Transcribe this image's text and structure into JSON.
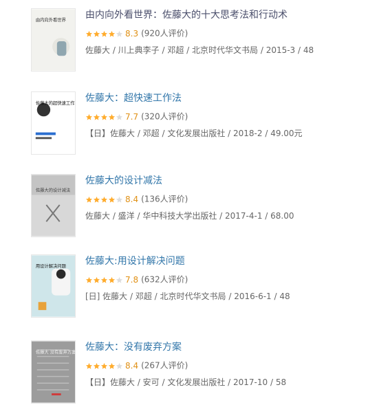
{
  "colors": {
    "title": "#37a",
    "star_on": "#ffac2d",
    "star_off": "#dddddd",
    "score": "#e09015",
    "meta": "#666666"
  },
  "books": [
    {
      "title": "由内向外看世界：佐藤大的十大思考法和行动术",
      "stars": 4,
      "score": "8.3",
      "count": "(920人评价)",
      "pub": "佐藤大 / 川上典李子 / 邓超 / 北京时代华文书局 / 2015-3 / 48",
      "title_color": "#4a4e6b",
      "cover": {
        "bg": "#f2f2ee",
        "text": "由内向外看世界",
        "text_color": "#333333",
        "accent": "#6a8a9a"
      }
    },
    {
      "title": "佐藤大：超快速工作法",
      "stars": 4,
      "score": "7.7",
      "count": "(320人评价)",
      "pub": "【日】佐藤大 / 邓超 / 文化发展出版社 / 2018-2 / 49.00元",
      "title_color": "#3377aa",
      "cover": {
        "bg": "#ffffff",
        "text": "佐藤大的超快速工作法",
        "text_color": "#111111",
        "accent": "#2b6fd0"
      }
    },
    {
      "title": "佐藤大的设计减法",
      "stars": 4,
      "score": "8.4",
      "count": "(136人评价)",
      "pub": "佐藤大 / 盛洋 / 华中科技大学出版社 / 2017-4-1 / 68.00",
      "title_color": "#3377aa",
      "cover": {
        "bg": "#d8d8d8",
        "text": "佐藤大的设计减法",
        "text_color": "#444444",
        "accent": "#9a9a9a"
      }
    },
    {
      "title": "佐藤大:用设计解决问题",
      "stars": 4,
      "score": "7.8",
      "count": "(632人评价)",
      "pub": "[日] 佐藤大 / 邓超 / 北京时代华文书局 / 2016-6-1 / 48",
      "title_color": "#3377aa",
      "cover": {
        "bg": "#cfe6ea",
        "text": "用设计解决问题",
        "text_color": "#1a1a1a",
        "accent": "#e8a23a"
      }
    },
    {
      "title": "佐藤大：没有废弃方案",
      "stars": 4,
      "score": "8.4",
      "count": "(267人评价)",
      "pub": "【日】佐藤大 / 安可 / 文化发展出版社 / 2017-10 / 58",
      "title_color": "#3377aa",
      "cover": {
        "bg": "#9c9c9c",
        "text": "佐藤大 没有废弃方案",
        "text_color": "#f0f0f0",
        "accent": "#d03a3a"
      }
    }
  ]
}
